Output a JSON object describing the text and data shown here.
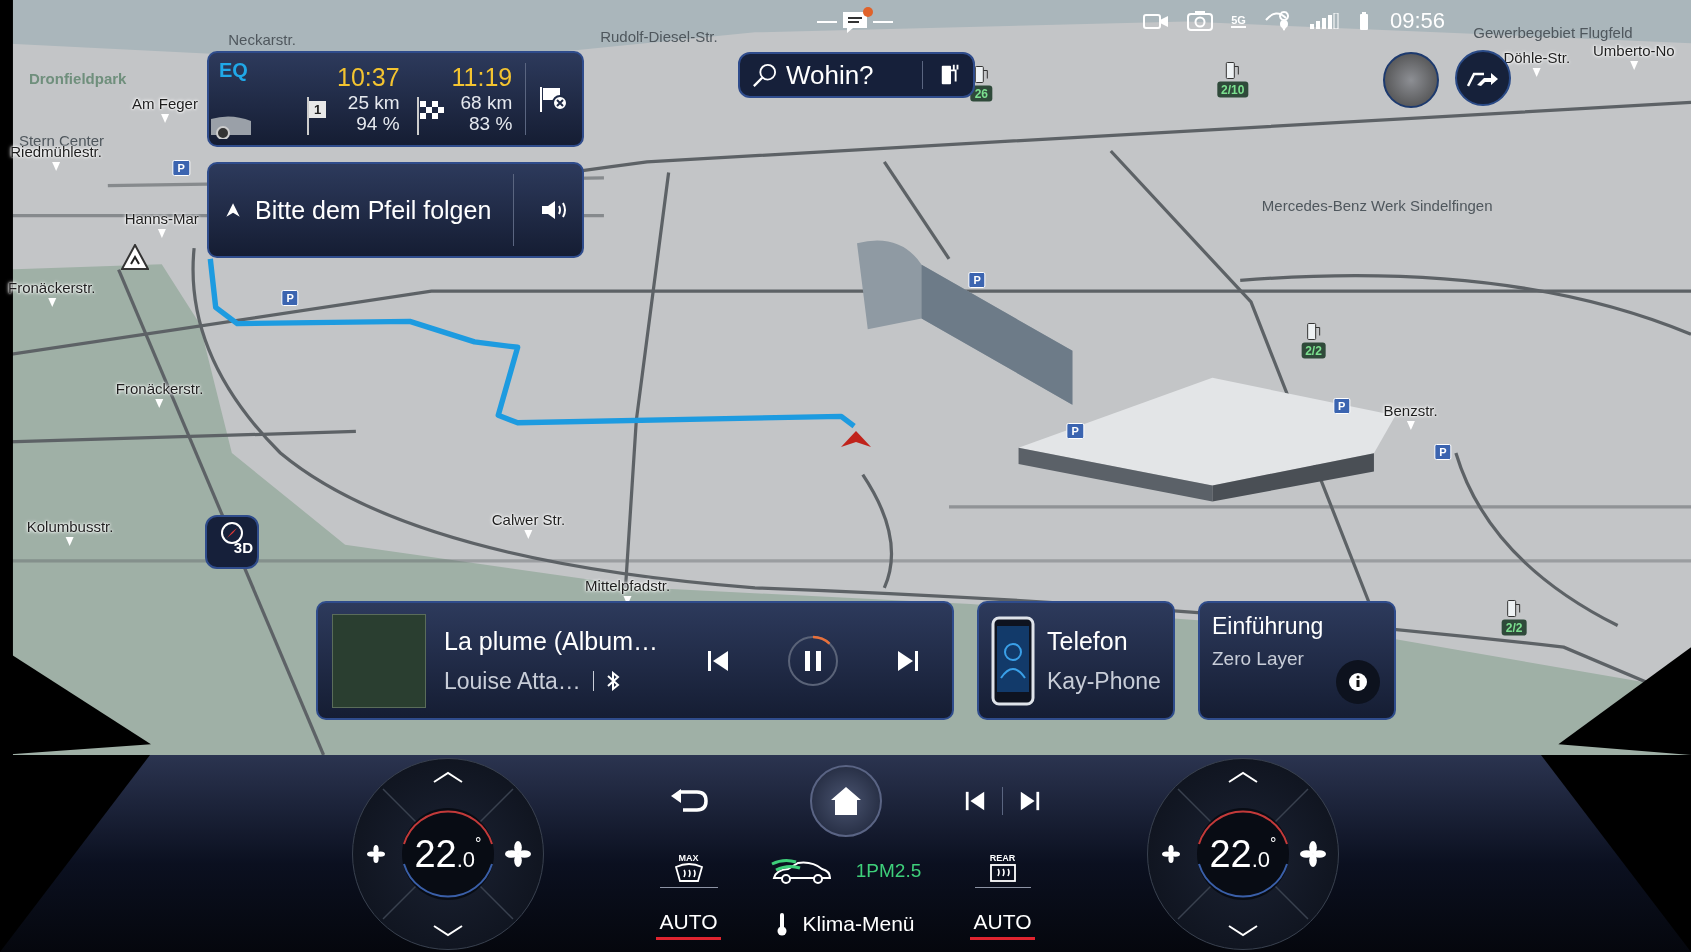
{
  "status_bar": {
    "notification": true,
    "network": "5G",
    "time": "09:56"
  },
  "route_card": {
    "brand": "EQ",
    "stops": [
      {
        "kind": "waypoint",
        "number": "1",
        "eta": "10:37",
        "distance": "25 km",
        "charge": "94 %"
      },
      {
        "kind": "destination",
        "eta": "11:19",
        "distance": "68 km",
        "charge": "83 %"
      }
    ]
  },
  "guidance": {
    "instruction": "Bitte dem Pfeil folgen"
  },
  "search": {
    "placeholder": "Wohin?"
  },
  "map": {
    "view_mode": "3D",
    "labels": [
      {
        "text": "Neckarstr.",
        "kind": "faint"
      },
      {
        "text": "Dronfieldpark",
        "kind": "park"
      },
      {
        "text": "Am Feger",
        "kind": "street"
      },
      {
        "text": "Stern Center",
        "kind": "faint"
      },
      {
        "text": "Riedmühlestr.",
        "kind": "street"
      },
      {
        "text": "Hanns-Mar",
        "kind": "street"
      },
      {
        "text": "Fronäckerstr.",
        "kind": "street"
      },
      {
        "text": "Fronäckerstr.",
        "kind": "street"
      },
      {
        "text": "Kolumbusstr.",
        "kind": "street"
      },
      {
        "text": "Calwer Str.",
        "kind": "street"
      },
      {
        "text": "Mittelpfadstr.",
        "kind": "street"
      },
      {
        "text": "Benzstr.",
        "kind": "street"
      },
      {
        "text": "Rudolf-Diesel-Str.",
        "kind": "faint"
      },
      {
        "text": "Mercedes-Benz Werk Sindelfingen",
        "kind": "faint"
      },
      {
        "text": "Gewerbegebiet Flugfeld",
        "kind": "faint"
      },
      {
        "text": "Döhle-Str.",
        "kind": "street"
      },
      {
        "text": "Umberto-No",
        "kind": "street"
      }
    ],
    "parking_signs": [
      "P",
      "P",
      "P",
      "P",
      "P",
      "P"
    ],
    "charging_badges": [
      "26",
      "2/10",
      "2/2",
      "2/2"
    ]
  },
  "media": {
    "title": "La plume (Album…",
    "artist": "Louise Atta…",
    "playing": true,
    "level": 0.12
  },
  "phone": {
    "title": "Telefon",
    "device": "Kay-Phone"
  },
  "info": {
    "title": "Einführung",
    "subtitle": "Zero Layer"
  },
  "climate": {
    "zones": [
      {
        "temp": "22",
        "decimal": ".0",
        "unit": "°"
      },
      {
        "temp": "22",
        "decimal": ".0",
        "unit": "°"
      }
    ],
    "defrost_label": "MAX",
    "rear_label": "REAR",
    "air_quality": "1PM2.5",
    "menu": "Klima-Menü",
    "auto_buttons": [
      {
        "label": "AUTO",
        "on": true
      },
      {
        "label": "AUTO",
        "on": true
      }
    ]
  }
}
